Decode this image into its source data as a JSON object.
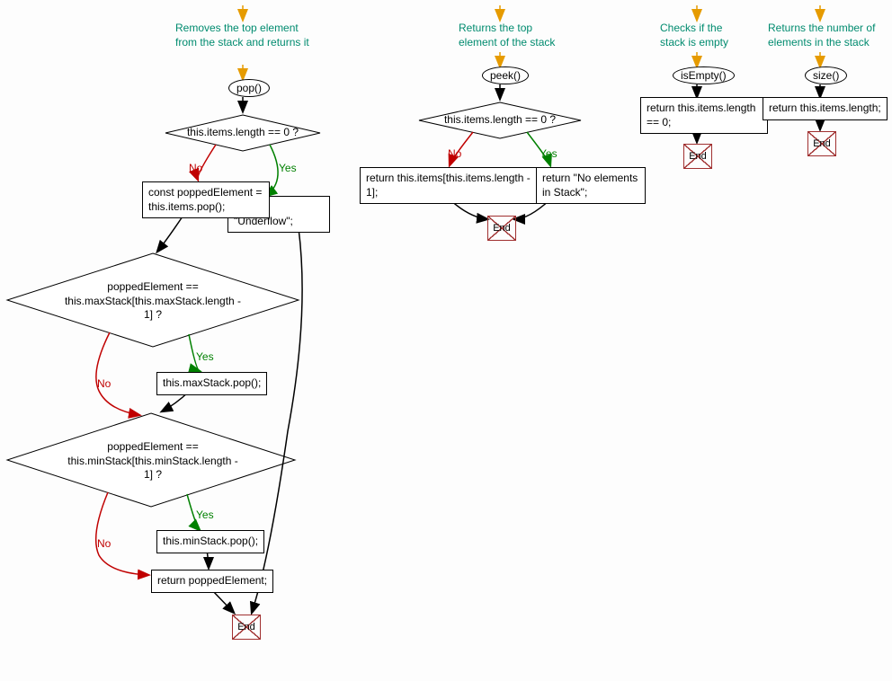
{
  "pop": {
    "comment": "Removes the top element from the stack and returns it",
    "func": "pop()",
    "decision1": "this.items.length == 0 ?",
    "yes1": "Yes",
    "no1": "No",
    "underflow": "return \"Underflow\";",
    "popped": "const poppedElement = this.items.pop();",
    "decision2": "poppedElement == this.maxStack[this.maxStack.length - 1] ?",
    "yes2": "Yes",
    "no2": "No",
    "maxpop": "this.maxStack.pop();",
    "decision3": "poppedElement == this.minStack[this.minStack.length - 1] ?",
    "yes3": "Yes",
    "no3": "No",
    "minpop": "this.minStack.pop();",
    "return": "return poppedElement;",
    "end": "End"
  },
  "peek": {
    "comment": "Returns the top element of the stack",
    "func": "peek()",
    "decision": "this.items.length == 0 ?",
    "yes": "Yes",
    "no": "No",
    "noElem": "return \"No elements in Stack\";",
    "top": "return this.items[this.items.length - 1];",
    "end": "End"
  },
  "isEmpty": {
    "comment": "Checks if the stack is empty",
    "func": "isEmpty()",
    "return": "return this.items.length == 0;",
    "end": "End"
  },
  "size": {
    "comment": "Returns the number of elements in the stack",
    "func": "size()",
    "return": "return this.items.length;",
    "end": "End"
  }
}
